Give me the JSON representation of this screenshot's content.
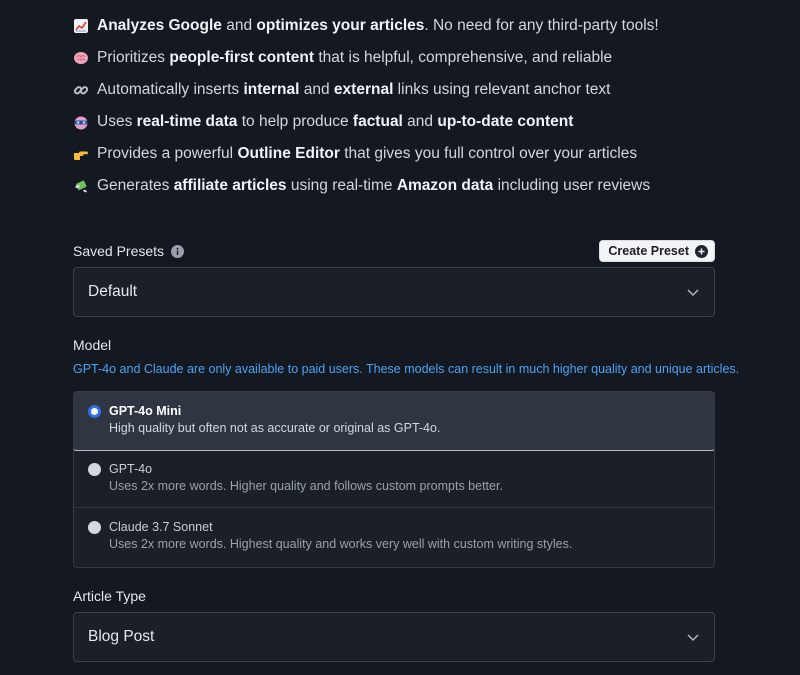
{
  "features": [
    {
      "icon": "chart-icon",
      "parts": [
        {
          "t": "Analyzes Google",
          "b": true
        },
        {
          "t": " and ",
          "b": false
        },
        {
          "t": "optimizes your articles",
          "b": true
        },
        {
          "t": ". No need for any third-party tools!",
          "b": false
        }
      ]
    },
    {
      "icon": "brain-icon",
      "parts": [
        {
          "t": "Prioritizes ",
          "b": false
        },
        {
          "t": "people-first content",
          "b": true
        },
        {
          "t": " that is helpful, comprehensive, and reliable",
          "b": false
        }
      ]
    },
    {
      "icon": "link-icon",
      "parts": [
        {
          "t": "Automatically inserts ",
          "b": false
        },
        {
          "t": "internal",
          "b": true
        },
        {
          "t": " and ",
          "b": false
        },
        {
          "t": "external",
          "b": true
        },
        {
          "t": " links using relevant anchor text",
          "b": false
        }
      ]
    },
    {
      "icon": "goggles-icon",
      "parts": [
        {
          "t": "Uses ",
          "b": false
        },
        {
          "t": "real-time data",
          "b": true
        },
        {
          "t": " to help produce ",
          "b": false
        },
        {
          "t": "factual",
          "b": true
        },
        {
          "t": " and ",
          "b": false
        },
        {
          "t": "up-to-date content",
          "b": true
        }
      ]
    },
    {
      "icon": "pointing-hand-icon",
      "parts": [
        {
          "t": "Provides a powerful ",
          "b": false
        },
        {
          "t": "Outline Editor",
          "b": true
        },
        {
          "t": " that gives you full control over your articles",
          "b": false
        }
      ]
    },
    {
      "icon": "money-wings-icon",
      "parts": [
        {
          "t": "Generates ",
          "b": false
        },
        {
          "t": "affiliate articles",
          "b": true
        },
        {
          "t": " using real-time ",
          "b": false
        },
        {
          "t": "Amazon data",
          "b": true
        },
        {
          "t": " including user reviews",
          "b": false
        }
      ]
    }
  ],
  "presets": {
    "label": "Saved Presets",
    "create_button": "Create Preset",
    "selected": "Default"
  },
  "model": {
    "label": "Model",
    "note": "GPT-4o and Claude are only available to paid users. These models can result in much higher quality and unique articles.",
    "options": [
      {
        "title": "GPT-4o Mini",
        "desc": "High quality but often not as accurate or original as GPT-4o.",
        "selected": true
      },
      {
        "title": "GPT-4o",
        "desc": "Uses 2x more words. Higher quality and follows custom prompts better.",
        "selected": false
      },
      {
        "title": "Claude 3.7 Sonnet",
        "desc": "Uses 2x more words. Highest quality and works very well with custom writing styles.",
        "selected": false
      }
    ]
  },
  "article_type": {
    "label": "Article Type",
    "selected": "Blog Post"
  },
  "colors": {
    "background": "#131821",
    "accent_blue": "#2f6fe5",
    "note_blue": "#4ea3f3"
  }
}
